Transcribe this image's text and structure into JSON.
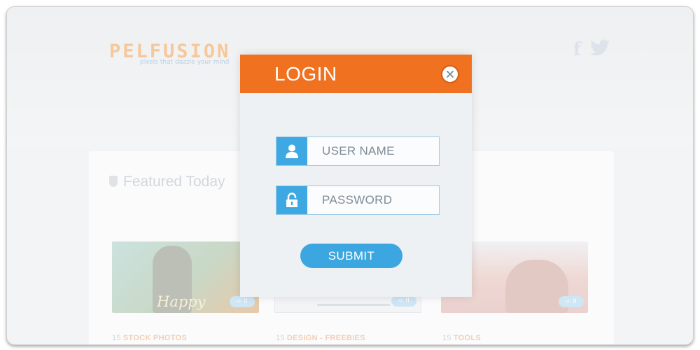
{
  "background": {
    "logo": "PELFUSION",
    "tagline": "pixels that dazzle your mind",
    "social": [
      {
        "icon": "facebook-icon",
        "glyph": "f"
      },
      {
        "icon": "twitter-icon",
        "glyph": "t"
      }
    ],
    "featured_heading": "Featured Today",
    "cards": [
      {
        "card_text": "Happy",
        "badge": "➪ ⅠⅠ",
        "category_num": "15",
        "category": "STOCK PHOTOS"
      },
      {
        "card_text": "",
        "badge": "➪ ⅠⅠ",
        "category_num": "15",
        "category": "DESIGN - FREEBIES"
      },
      {
        "card_text": "",
        "badge": "➪ ⅠⅠ",
        "category_num": "15",
        "category": "TOOLS"
      }
    ]
  },
  "modal": {
    "title": "LOGIN",
    "close_icon": "close-icon",
    "username_placeholder": "USER NAME",
    "password_placeholder": "PASSWORD",
    "submit_label": "SUBMIT",
    "colors": {
      "header": "#f0711f",
      "accent": "#3da8e2",
      "panel": "#edf1f3"
    }
  }
}
